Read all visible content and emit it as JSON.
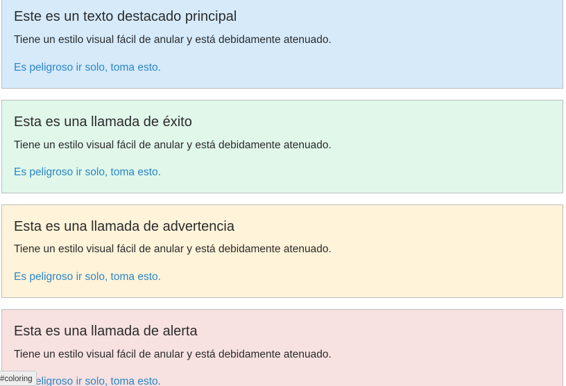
{
  "callouts": [
    {
      "variant": "primary",
      "background": "#d6eafa",
      "title": "Este es un texto destacado principal",
      "body": "Tiene un estilo visual fácil de anular y está debidamente atenuado.",
      "link": "Es peligroso ir solo, toma esto."
    },
    {
      "variant": "success",
      "background": "#e0f7ea",
      "title": "Esta es una llamada de éxito",
      "body": "Tiene un estilo visual fácil de anular y está debidamente atenuado.",
      "link": "Es peligroso ir solo, toma esto."
    },
    {
      "variant": "warning",
      "background": "#fff3d9",
      "title": "Esta es una llamada de advertencia",
      "body": "Tiene un estilo visual fácil de anular y está debidamente atenuado.",
      "link": "Es peligroso ir solo, toma esto."
    },
    {
      "variant": "alert",
      "background": "#f7e1e1",
      "title": "Esta es una llamada de alerta",
      "body": "Tiene un estilo visual fácil de anular y está debidamente atenuado.",
      "link": "Es peligroso ir solo, toma esto."
    }
  ],
  "status_chip": "#coloring",
  "link_color": "#2a86c6"
}
